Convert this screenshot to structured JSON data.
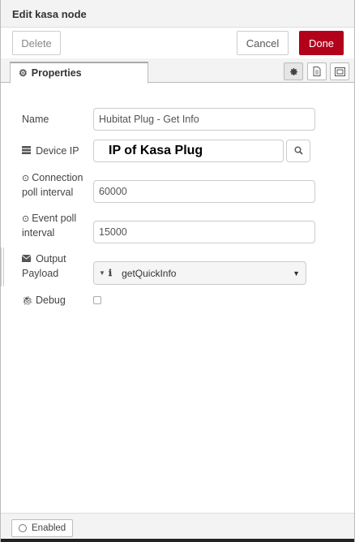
{
  "header": {
    "title": "Edit kasa node"
  },
  "toolbar": {
    "delete_label": "Delete",
    "cancel_label": "Cancel",
    "done_label": "Done",
    "done_color": "#b3001b"
  },
  "tabs": [
    {
      "label": "Properties"
    }
  ],
  "form": {
    "name": {
      "label": "Name",
      "value": "Hubitat Plug - Get Info"
    },
    "device_ip": {
      "label": "Device IP",
      "value": "IP of Kasa Plug"
    },
    "connection_poll": {
      "label_line1": "Connection",
      "label_line2": "poll interval",
      "value": "60000"
    },
    "event_poll": {
      "label_line1": "Event poll",
      "label_line2": "interval",
      "value": "15000"
    },
    "output_payload": {
      "label_line1": "Output",
      "label_line2": "Payload",
      "value": "getQuickInfo"
    },
    "debug": {
      "label": "Debug",
      "checked": false
    }
  },
  "footer": {
    "enabled_label": "Enabled"
  }
}
